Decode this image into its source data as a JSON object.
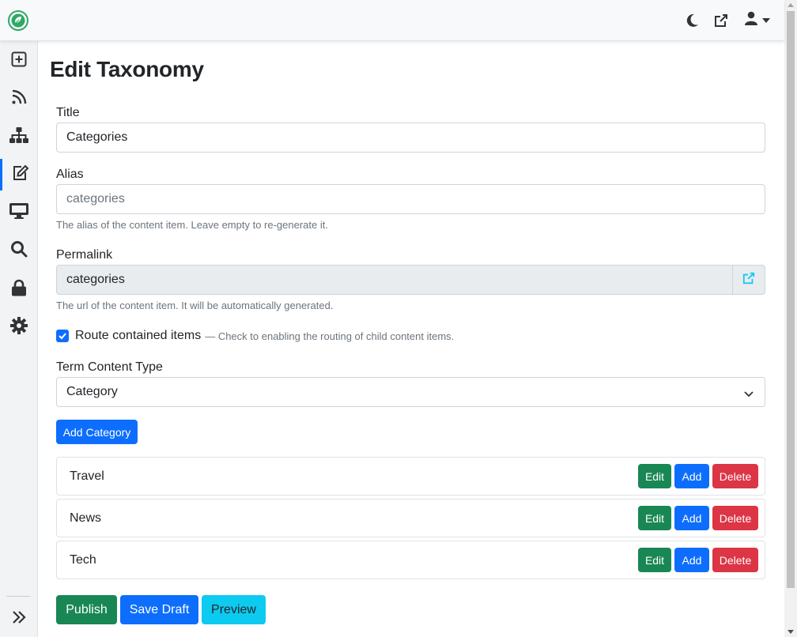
{
  "colors": {
    "primary": "#0d6efd",
    "success": "#198754",
    "danger": "#dc3545",
    "info": "#0dcaf0",
    "brand_green": "#2fa866"
  },
  "header": {
    "logo_icon": "leaf-logo-icon",
    "icons": [
      "moon-icon",
      "external-link-icon",
      "user-icon"
    ]
  },
  "sidebar": {
    "items": [
      {
        "icon": "plus-square-icon"
      },
      {
        "icon": "rss-icon"
      },
      {
        "icon": "sitemap-icon"
      },
      {
        "icon": "edit-icon",
        "active": true
      },
      {
        "icon": "desktop-icon"
      },
      {
        "icon": "search-icon"
      },
      {
        "icon": "lock-icon"
      },
      {
        "icon": "gear-icon"
      }
    ],
    "toggle_icon": "double-chevron-right-icon"
  },
  "page": {
    "title": "Edit Taxonomy"
  },
  "form": {
    "title_label": "Title",
    "title_value": "Categories",
    "alias_label": "Alias",
    "alias_placeholder": "categories",
    "alias_help": "The alias of the content item. Leave empty to re-generate it.",
    "permalink_label": "Permalink",
    "permalink_value": "categories",
    "permalink_help": "The url of the content item. It will be automatically generated.",
    "route_label": "Route contained items",
    "route_help": "— Check to enabling the routing of child content items.",
    "route_checked": true,
    "term_type_label": "Term Content Type",
    "term_type_value": "Category",
    "add_button": "Add Category"
  },
  "terms": [
    {
      "name": "Travel",
      "edit": "Edit",
      "add": "Add",
      "delete": "Delete"
    },
    {
      "name": "News",
      "edit": "Edit",
      "add": "Add",
      "delete": "Delete"
    },
    {
      "name": "Tech",
      "edit": "Edit",
      "add": "Add",
      "delete": "Delete"
    }
  ],
  "footer": {
    "publish": "Publish",
    "save_draft": "Save Draft",
    "preview": "Preview"
  }
}
